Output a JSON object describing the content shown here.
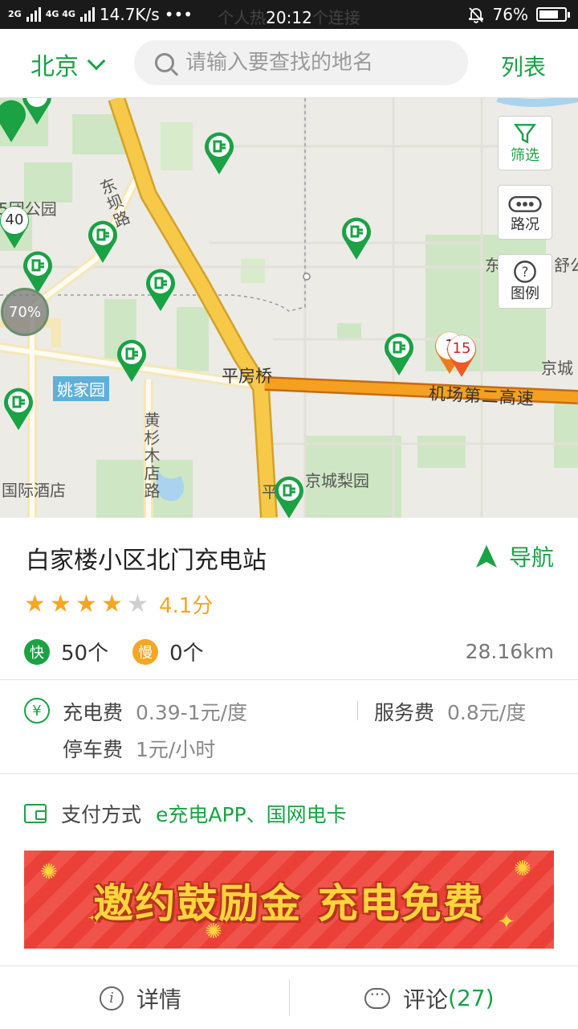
{
  "status_bar": {
    "network": "2G",
    "network2": "4G 4G",
    "speed": "14.7K/s",
    "dots": "•••",
    "ghost_left": "个人热",
    "time": "20:12",
    "ghost_right": "个连接",
    "battery": "76%",
    "battery_level": 0.76
  },
  "header": {
    "city": "北京",
    "search_placeholder": "请输入要查找的地名",
    "list_label": "列表"
  },
  "map": {
    "controls": {
      "filter_label": "筛选",
      "traffic_label": "路况",
      "legend_label": "图例"
    },
    "labels": {
      "park": "团公园",
      "park_prefix": "5",
      "bridge": "平房桥",
      "expressway": "机场第二高速",
      "yaojia": "姚家园",
      "jingcheng_garden": "京城梨园",
      "hotel": "国际酒店",
      "road_huangshan": "黄杉木店路",
      "road_dongba": "东坝路",
      "dongfeng": "东",
      "jingcheng": "京城",
      "shugong": "舒公",
      "ping": "平"
    },
    "cluster_pct": "70%",
    "pin_numbers": [
      "40",
      "1",
      "15"
    ]
  },
  "station": {
    "name": "白家楼小区北门充电站",
    "nav_label": "导航",
    "rating": 4.1,
    "score_text": "4.1分",
    "fast_label": "快",
    "fast_count": "50个",
    "slow_label": "慢",
    "slow_count": "0个",
    "distance": "28.16km"
  },
  "fees": {
    "currency_symbol": "¥",
    "charge_label": "充电费",
    "charge_value": "0.39-1元/度",
    "service_label": "服务费",
    "service_value": "0.8元/度",
    "parking_label": "停车费",
    "parking_value": "1元/小时"
  },
  "payment": {
    "label": "支付方式",
    "methods": "e充电APP、国网电卡"
  },
  "banner": {
    "text": "邀约鼓励金 充电免费"
  },
  "bottom_bar": {
    "details_label": "详情",
    "comments_label": "评论",
    "comments_count": "(27)"
  },
  "colors": {
    "accent": "#1aa245",
    "rating": "#f5a623",
    "expressway": "#f5a020",
    "road": "#f7c948"
  }
}
